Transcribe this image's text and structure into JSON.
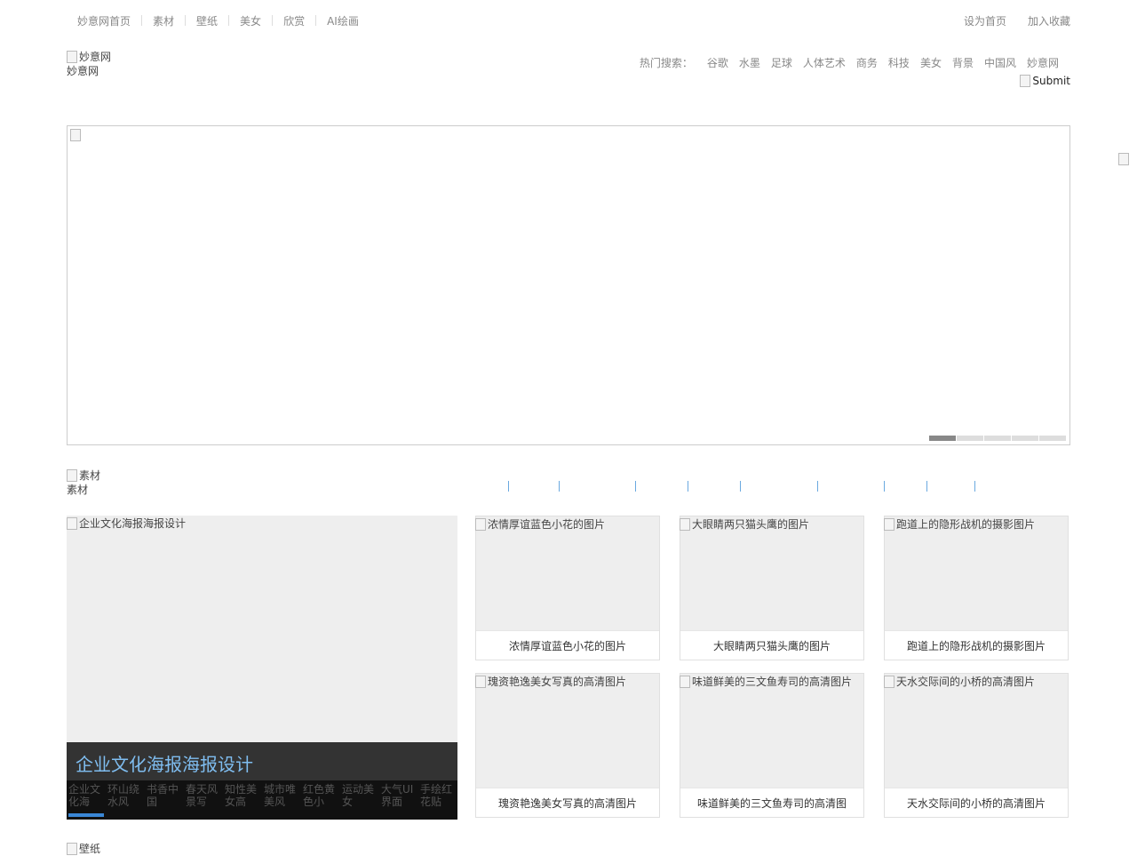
{
  "top_nav": {
    "left": [
      "妙意网首页",
      "素材",
      "壁纸",
      "美女",
      "欣赏",
      "AI绘画"
    ],
    "right": [
      "设为首页",
      "加入收藏"
    ]
  },
  "header": {
    "logo_alt": "妙意网",
    "logo_text": "妙意网",
    "hot_label": "热门搜索：",
    "hot_terms": [
      "谷歌",
      "水墨",
      "足球",
      "人体艺术",
      "商务",
      "科技",
      "美女",
      "背景",
      "中国风",
      "妙意网"
    ],
    "submit_alt": "Submit"
  },
  "banner": {
    "slide_count": 5,
    "active_slide": 1
  },
  "section1": {
    "icon_alt": "素材",
    "title": "素材"
  },
  "feature": {
    "image_alt": "企业文化海报海报设计",
    "caption": "企业文化海报海报设计",
    "thumbs": [
      "企业文化海",
      "环山绕水风",
      "书香中国",
      "春天风景写",
      "知性美女高",
      "城市唯美风",
      "红色黄色小",
      "运动美女",
      "大气UI界面",
      "手绘红花贴"
    ]
  },
  "cards": [
    {
      "alt": "浓情厚谊蓝色小花的图片",
      "title": "浓情厚谊蓝色小花的图片"
    },
    {
      "alt": "大眼睛两只猫头鹰的图片",
      "title": "大眼睛两只猫头鹰的图片"
    },
    {
      "alt": "跑道上的隐形战机的摄影图片",
      "title": "跑道上的隐形战机的摄影图片"
    },
    {
      "alt": "瑰资艳逸美女写真的高清图片",
      "title": "瑰资艳逸美女写真的高清图片"
    },
    {
      "alt": "味道鲜美的三文鱼寿司的高清图片",
      "title": "味道鲜美的三文鱼寿司的高清图"
    },
    {
      "alt": "天水交际间的小桥的高清图片",
      "title": "天水交际间的小桥的高清图片"
    }
  ],
  "section2": {
    "icon_alt": "壁纸"
  }
}
